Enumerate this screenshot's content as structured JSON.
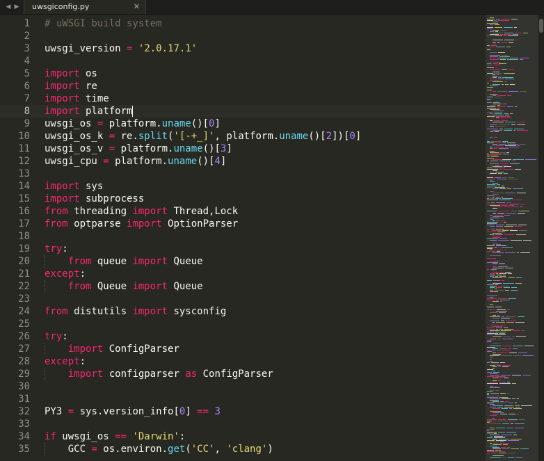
{
  "tabs": [
    {
      "label": "uwsgiconfig.py",
      "close_glyph": "✕",
      "active": true
    }
  ],
  "nav": {
    "back_glyph": "◀",
    "forward_glyph": "▶"
  },
  "editor": {
    "current_line": 8,
    "lines": [
      {
        "n": 1,
        "indent": 0,
        "tokens": [
          [
            "# uWSGI build system",
            "cmt"
          ]
        ]
      },
      {
        "n": 2,
        "indent": 0,
        "tokens": []
      },
      {
        "n": 3,
        "indent": 0,
        "tokens": [
          [
            "uwsgi_version ",
            "pl"
          ],
          [
            "=",
            "op"
          ],
          [
            " ",
            "pl"
          ],
          [
            "'2.0.17.1'",
            "str"
          ]
        ]
      },
      {
        "n": 4,
        "indent": 0,
        "tokens": []
      },
      {
        "n": 5,
        "indent": 0,
        "tokens": [
          [
            "import",
            "kw"
          ],
          [
            " os",
            "pl"
          ]
        ]
      },
      {
        "n": 6,
        "indent": 0,
        "tokens": [
          [
            "import",
            "kw"
          ],
          [
            " re",
            "pl"
          ]
        ]
      },
      {
        "n": 7,
        "indent": 0,
        "tokens": [
          [
            "import",
            "kw"
          ],
          [
            " time",
            "pl"
          ]
        ]
      },
      {
        "n": 8,
        "indent": 0,
        "tokens": [
          [
            "import",
            "kw"
          ],
          [
            " platform",
            "pl"
          ]
        ]
      },
      {
        "n": 9,
        "indent": 0,
        "tokens": [
          [
            "uwsgi_os ",
            "pl"
          ],
          [
            "=",
            "op"
          ],
          [
            " platform.",
            "pl"
          ],
          [
            "uname",
            "fn"
          ],
          [
            "()[",
            "pl"
          ],
          [
            "0",
            "num"
          ],
          [
            "]",
            "pl"
          ]
        ]
      },
      {
        "n": 10,
        "indent": 0,
        "tokens": [
          [
            "uwsgi_os_k ",
            "pl"
          ],
          [
            "=",
            "op"
          ],
          [
            " re.",
            "pl"
          ],
          [
            "split",
            "fn"
          ],
          [
            "(",
            "pl"
          ],
          [
            "'[-+_]'",
            "str"
          ],
          [
            ", platform.",
            "pl"
          ],
          [
            "uname",
            "fn"
          ],
          [
            "()[",
            "pl"
          ],
          [
            "2",
            "num"
          ],
          [
            "])[",
            "pl"
          ],
          [
            "0",
            "num"
          ],
          [
            "]",
            "pl"
          ]
        ]
      },
      {
        "n": 11,
        "indent": 0,
        "tokens": [
          [
            "uwsgi_os_v ",
            "pl"
          ],
          [
            "=",
            "op"
          ],
          [
            " platform.",
            "pl"
          ],
          [
            "uname",
            "fn"
          ],
          [
            "()[",
            "pl"
          ],
          [
            "3",
            "num"
          ],
          [
            "]",
            "pl"
          ]
        ]
      },
      {
        "n": 12,
        "indent": 0,
        "tokens": [
          [
            "uwsgi_cpu ",
            "pl"
          ],
          [
            "=",
            "op"
          ],
          [
            " platform.",
            "pl"
          ],
          [
            "uname",
            "fn"
          ],
          [
            "()[",
            "pl"
          ],
          [
            "4",
            "num"
          ],
          [
            "]",
            "pl"
          ]
        ]
      },
      {
        "n": 13,
        "indent": 0,
        "tokens": []
      },
      {
        "n": 14,
        "indent": 0,
        "tokens": [
          [
            "import",
            "kw"
          ],
          [
            " sys",
            "pl"
          ]
        ]
      },
      {
        "n": 15,
        "indent": 0,
        "tokens": [
          [
            "import",
            "kw"
          ],
          [
            " subprocess",
            "pl"
          ]
        ]
      },
      {
        "n": 16,
        "indent": 0,
        "tokens": [
          [
            "from",
            "kw"
          ],
          [
            " threading ",
            "pl"
          ],
          [
            "import",
            "kw"
          ],
          [
            " Thread,Lock",
            "pl"
          ]
        ]
      },
      {
        "n": 17,
        "indent": 0,
        "tokens": [
          [
            "from",
            "kw"
          ],
          [
            " optparse ",
            "pl"
          ],
          [
            "import",
            "kw"
          ],
          [
            " OptionParser",
            "pl"
          ]
        ]
      },
      {
        "n": 18,
        "indent": 0,
        "tokens": []
      },
      {
        "n": 19,
        "indent": 0,
        "tokens": [
          [
            "try",
            "kw"
          ],
          [
            ":",
            "pl"
          ]
        ]
      },
      {
        "n": 20,
        "indent": 1,
        "tokens": [
          [
            "    ",
            "pl"
          ],
          [
            "from",
            "kw"
          ],
          [
            " queue ",
            "pl"
          ],
          [
            "import",
            "kw"
          ],
          [
            " Queue",
            "pl"
          ]
        ]
      },
      {
        "n": 21,
        "indent": 0,
        "tokens": [
          [
            "except",
            "kw"
          ],
          [
            ":",
            "pl"
          ]
        ]
      },
      {
        "n": 22,
        "indent": 1,
        "tokens": [
          [
            "    ",
            "pl"
          ],
          [
            "from",
            "kw"
          ],
          [
            " Queue ",
            "pl"
          ],
          [
            "import",
            "kw"
          ],
          [
            " Queue",
            "pl"
          ]
        ]
      },
      {
        "n": 23,
        "indent": 0,
        "tokens": []
      },
      {
        "n": 24,
        "indent": 0,
        "tokens": [
          [
            "from",
            "kw"
          ],
          [
            " distutils ",
            "pl"
          ],
          [
            "import",
            "kw"
          ],
          [
            " sysconfig",
            "pl"
          ]
        ]
      },
      {
        "n": 25,
        "indent": 0,
        "tokens": []
      },
      {
        "n": 26,
        "indent": 0,
        "tokens": [
          [
            "try",
            "kw"
          ],
          [
            ":",
            "pl"
          ]
        ]
      },
      {
        "n": 27,
        "indent": 1,
        "tokens": [
          [
            "    ",
            "pl"
          ],
          [
            "import",
            "kw"
          ],
          [
            " ConfigParser",
            "pl"
          ]
        ]
      },
      {
        "n": 28,
        "indent": 0,
        "tokens": [
          [
            "except",
            "kw"
          ],
          [
            ":",
            "pl"
          ]
        ]
      },
      {
        "n": 29,
        "indent": 1,
        "tokens": [
          [
            "    ",
            "pl"
          ],
          [
            "import",
            "kw"
          ],
          [
            " configparser ",
            "pl"
          ],
          [
            "as",
            "kw"
          ],
          [
            " ConfigParser",
            "pl"
          ]
        ]
      },
      {
        "n": 30,
        "indent": 0,
        "tokens": []
      },
      {
        "n": 31,
        "indent": 0,
        "tokens": []
      },
      {
        "n": 32,
        "indent": 0,
        "tokens": [
          [
            "PY3 ",
            "pl"
          ],
          [
            "=",
            "op"
          ],
          [
            " sys.version_info[",
            "pl"
          ],
          [
            "0",
            "num"
          ],
          [
            "] ",
            "pl"
          ],
          [
            "==",
            "op"
          ],
          [
            " ",
            "pl"
          ],
          [
            "3",
            "num"
          ]
        ]
      },
      {
        "n": 33,
        "indent": 0,
        "tokens": []
      },
      {
        "n": 34,
        "indent": 0,
        "tokens": [
          [
            "if",
            "kw"
          ],
          [
            " uwsgi_os ",
            "pl"
          ],
          [
            "==",
            "op"
          ],
          [
            " ",
            "pl"
          ],
          [
            "'Darwin'",
            "str"
          ],
          [
            ":",
            "pl"
          ]
        ]
      },
      {
        "n": 35,
        "indent": 1,
        "tokens": [
          [
            "    GCC ",
            "pl"
          ],
          [
            "=",
            "op"
          ],
          [
            " os.environ.",
            "pl"
          ],
          [
            "get",
            "fn"
          ],
          [
            "(",
            "pl"
          ],
          [
            "'CC'",
            "str"
          ],
          [
            ", ",
            "pl"
          ],
          [
            "'clang'",
            "str"
          ],
          [
            ")",
            "pl"
          ]
        ]
      }
    ]
  },
  "colors": {
    "background": "#272822",
    "comment": "#75715e",
    "keyword": "#f92672",
    "string": "#e6db74",
    "number": "#ae81ff",
    "function": "#66d9ef",
    "plain": "#f8f8f2",
    "line_number": "#8f908a"
  }
}
